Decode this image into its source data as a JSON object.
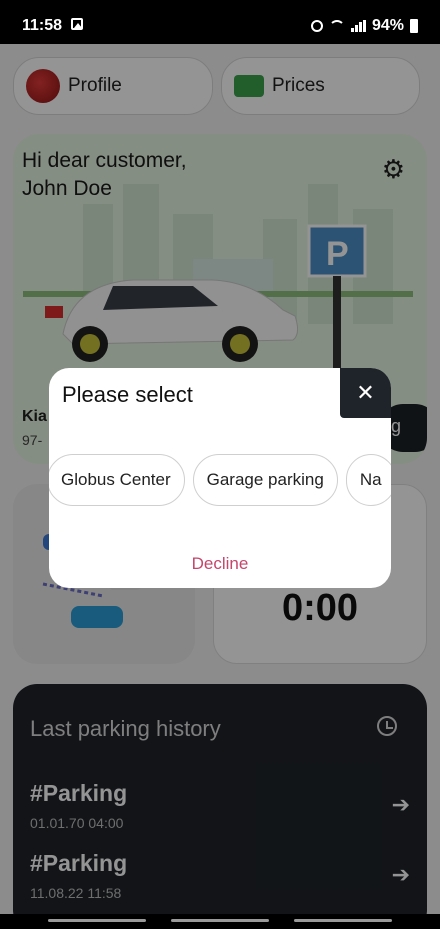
{
  "status": {
    "time": "11:58",
    "battery": "94%"
  },
  "top_buttons": {
    "profile": "Profile",
    "prices": "Prices"
  },
  "hero": {
    "greeting": "Hi dear customer,",
    "customer": "John Doe",
    "car_name": "Kia",
    "plate": "97-",
    "action_label": "g"
  },
  "timer": {
    "value": "0:00"
  },
  "history": {
    "title": "Last parking history",
    "items": [
      {
        "name": "#Parking",
        "date": "01.01.70 04:00"
      },
      {
        "name": "#Parking",
        "date": "11.08.22 11:58"
      }
    ]
  },
  "dialog": {
    "title": "Please select",
    "options": [
      "Globus Center",
      "Garage parking",
      "Na"
    ],
    "decline": "Decline"
  },
  "colors": {
    "accent": "#c5456d",
    "dark": "#1f242a"
  }
}
